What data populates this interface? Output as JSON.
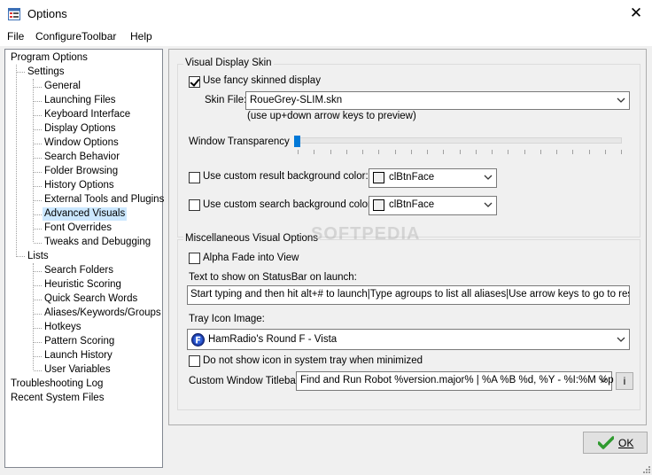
{
  "window": {
    "title": "Options"
  },
  "menu": [
    "File",
    "ConfigureToolbar",
    "Help"
  ],
  "tree": {
    "program_options": "Program Options",
    "settings": "Settings",
    "settings_items": [
      "General",
      "Launching Files",
      "Keyboard Interface",
      "Display Options",
      "Window Options",
      "Search Behavior",
      "Folder Browsing",
      "History Options",
      "External Tools and Plugins",
      "Advanced Visuals",
      "Font Overrides",
      "Tweaks and Debugging"
    ],
    "selected": "Advanced Visuals",
    "lists": "Lists",
    "lists_items": [
      "Search Folders",
      "Heuristic Scoring",
      "Quick Search Words",
      "Aliases/Keywords/Groups",
      "Hotkeys",
      "Pattern Scoring",
      "Launch History",
      "User Variables"
    ],
    "troubleshooting": "Troubleshooting Log",
    "recent": "Recent System Files"
  },
  "visual_skin": {
    "group_title": "Visual Display Skin",
    "use_fancy_label": "Use fancy skinned display",
    "use_fancy_checked": true,
    "skin_file_label": "Skin File:",
    "skin_file_value": "RoueGrey-SLIM.skn",
    "skin_hint": "(use up+down arrow keys to preview)",
    "transparency_label": "Window Transparency",
    "transparency_value": 0,
    "custom_result_label": "Use custom result background color:",
    "custom_result_value": "clBtnFace",
    "custom_search_label": "Use custom search background color:",
    "custom_search_value": "clBtnFace"
  },
  "misc": {
    "group_title": "Miscellaneous Visual Options",
    "alpha_fade_label": "Alpha Fade into View",
    "statusbar_label": "Text to show on StatusBar on launch:",
    "statusbar_value": "Start typing and then hit alt+# to launch|Type agroups to list all aliases|Use arrow keys to go to results|Hit",
    "tray_label": "Tray Icon Image:",
    "tray_value": "HamRadio's Round F - Vista",
    "no_tray_label": "Do not show icon in system tray when minimized",
    "titlebar_label": "Custom Window Titlebar:",
    "titlebar_value": "Find and Run Robot %version.major% | %A %B %d, %Y  -  %I:%M %p",
    "info_button": "i"
  },
  "ok_button": "OK",
  "watermark": "SOFTPEDIA"
}
